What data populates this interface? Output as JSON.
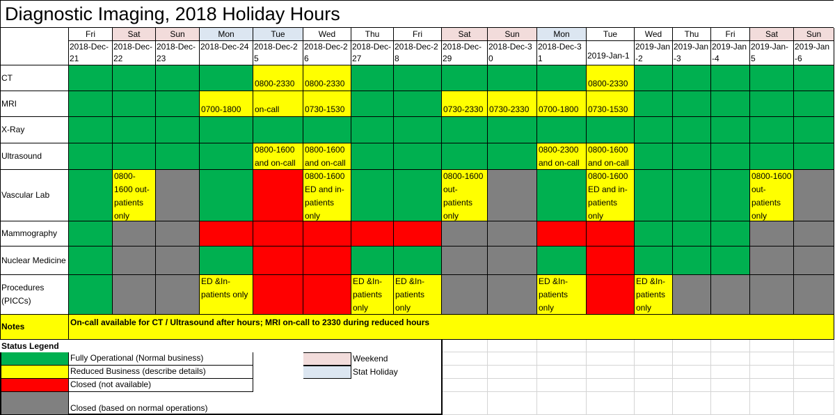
{
  "title": "Diagnostic Imaging, 2018 Holiday Hours",
  "columns": [
    {
      "day": "Fri",
      "date": "2018-Dec-21",
      "bg": "W"
    },
    {
      "day": "Sat",
      "date": "2018-Dec-22",
      "bg": "P"
    },
    {
      "day": "Sun",
      "date": "2018-Dec-23",
      "bg": "P"
    },
    {
      "day": "Mon",
      "date": "2018-Dec-24",
      "bg": "B"
    },
    {
      "day": "Tue",
      "date": "2018-Dec-25",
      "bg": "B"
    },
    {
      "day": "Wed",
      "date": "2018-Dec-26",
      "bg": "W"
    },
    {
      "day": "Thu",
      "date": "2018-Dec-27",
      "bg": "W"
    },
    {
      "day": "Fri",
      "date": "2018-Dec-28",
      "bg": "W"
    },
    {
      "day": "Sat",
      "date": "2018-Dec-29",
      "bg": "P"
    },
    {
      "day": "Sun",
      "date": "2018-Dec-30",
      "bg": "P"
    },
    {
      "day": "Mon",
      "date": "2018-Dec-31",
      "bg": "B"
    },
    {
      "day": "Tue",
      "date": "2019-Jan-1",
      "bg": "W"
    },
    {
      "day": "Wed",
      "date": "2019-Jan-2",
      "bg": "W"
    },
    {
      "day": "Thu",
      "date": "2019-Jan-3",
      "bg": "W"
    },
    {
      "day": "Fri",
      "date": "2019-Jan-4",
      "bg": "W"
    },
    {
      "day": "Sat",
      "date": "2019-Jan-5",
      "bg": "P"
    },
    {
      "day": "Sun",
      "date": "2019-Jan-6",
      "bg": "P"
    }
  ],
  "rows": [
    {
      "label": "CT",
      "cells": [
        {
          "s": "G",
          "t": ""
        },
        {
          "s": "G",
          "t": ""
        },
        {
          "s": "G",
          "t": ""
        },
        {
          "s": "G",
          "t": ""
        },
        {
          "s": "Y",
          "t": "0800-2330"
        },
        {
          "s": "Y",
          "t": "0800-2330"
        },
        {
          "s": "G",
          "t": ""
        },
        {
          "s": "G",
          "t": ""
        },
        {
          "s": "G",
          "t": ""
        },
        {
          "s": "G",
          "t": ""
        },
        {
          "s": "G",
          "t": ""
        },
        {
          "s": "Y",
          "t": "0800-2330"
        },
        {
          "s": "G",
          "t": ""
        },
        {
          "s": "G",
          "t": ""
        },
        {
          "s": "G",
          "t": ""
        },
        {
          "s": "G",
          "t": ""
        },
        {
          "s": "G",
          "t": ""
        }
      ]
    },
    {
      "label": "MRI",
      "cells": [
        {
          "s": "G",
          "t": ""
        },
        {
          "s": "G",
          "t": ""
        },
        {
          "s": "G",
          "t": ""
        },
        {
          "s": "Y",
          "t": "0700-1800"
        },
        {
          "s": "Y",
          "t": "on-call"
        },
        {
          "s": "Y",
          "t": "0730-1530"
        },
        {
          "s": "G",
          "t": ""
        },
        {
          "s": "G",
          "t": ""
        },
        {
          "s": "Y",
          "t": "0730-2330"
        },
        {
          "s": "Y",
          "t": "0730-2330"
        },
        {
          "s": "Y",
          "t": "0700-1800"
        },
        {
          "s": "Y",
          "t": "0730-1530"
        },
        {
          "s": "G",
          "t": ""
        },
        {
          "s": "G",
          "t": ""
        },
        {
          "s": "G",
          "t": ""
        },
        {
          "s": "G",
          "t": ""
        },
        {
          "s": "G",
          "t": ""
        }
      ]
    },
    {
      "label": "X-Ray",
      "cells": [
        {
          "s": "G",
          "t": ""
        },
        {
          "s": "G",
          "t": ""
        },
        {
          "s": "G",
          "t": ""
        },
        {
          "s": "G",
          "t": ""
        },
        {
          "s": "G",
          "t": ""
        },
        {
          "s": "G",
          "t": ""
        },
        {
          "s": "G",
          "t": ""
        },
        {
          "s": "G",
          "t": ""
        },
        {
          "s": "G",
          "t": ""
        },
        {
          "s": "G",
          "t": ""
        },
        {
          "s": "G",
          "t": ""
        },
        {
          "s": "G",
          "t": ""
        },
        {
          "s": "G",
          "t": ""
        },
        {
          "s": "G",
          "t": ""
        },
        {
          "s": "G",
          "t": ""
        },
        {
          "s": "G",
          "t": ""
        },
        {
          "s": "G",
          "t": ""
        }
      ]
    },
    {
      "label": "Ultrasound",
      "cells": [
        {
          "s": "G",
          "t": ""
        },
        {
          "s": "G",
          "t": ""
        },
        {
          "s": "G",
          "t": ""
        },
        {
          "s": "G",
          "t": ""
        },
        {
          "s": "Y",
          "t": "0800-1600 and on-call"
        },
        {
          "s": "Y",
          "t": "0800-1600 and on-call"
        },
        {
          "s": "G",
          "t": ""
        },
        {
          "s": "G",
          "t": ""
        },
        {
          "s": "G",
          "t": ""
        },
        {
          "s": "G",
          "t": ""
        },
        {
          "s": "Y",
          "t": "0800-2300 and on-call"
        },
        {
          "s": "Y",
          "t": "0800-1600 and on-call"
        },
        {
          "s": "G",
          "t": ""
        },
        {
          "s": "G",
          "t": ""
        },
        {
          "s": "G",
          "t": ""
        },
        {
          "s": "G",
          "t": ""
        },
        {
          "s": "G",
          "t": ""
        }
      ]
    },
    {
      "label": "Vascular Lab",
      "cells": [
        {
          "s": "G",
          "t": ""
        },
        {
          "s": "Y",
          "t": "0800-1600 out-patients only"
        },
        {
          "s": "X",
          "t": ""
        },
        {
          "s": "G",
          "t": ""
        },
        {
          "s": "R",
          "t": ""
        },
        {
          "s": "Y",
          "t": "0800-1600 ED and in-patients only"
        },
        {
          "s": "G",
          "t": ""
        },
        {
          "s": "G",
          "t": ""
        },
        {
          "s": "Y",
          "t": "0800-1600 out-patients only"
        },
        {
          "s": "X",
          "t": ""
        },
        {
          "s": "G",
          "t": ""
        },
        {
          "s": "Y",
          "t": "0800-1600 ED and in-patients only"
        },
        {
          "s": "G",
          "t": ""
        },
        {
          "s": "G",
          "t": ""
        },
        {
          "s": "G",
          "t": ""
        },
        {
          "s": "Y",
          "t": "0800-1600 out-patients only"
        },
        {
          "s": "X",
          "t": ""
        }
      ]
    },
    {
      "label": "Mammography",
      "cells": [
        {
          "s": "G",
          "t": ""
        },
        {
          "s": "X",
          "t": ""
        },
        {
          "s": "X",
          "t": ""
        },
        {
          "s": "R",
          "t": ""
        },
        {
          "s": "R",
          "t": ""
        },
        {
          "s": "R",
          "t": ""
        },
        {
          "s": "R",
          "t": ""
        },
        {
          "s": "R",
          "t": ""
        },
        {
          "s": "X",
          "t": ""
        },
        {
          "s": "X",
          "t": ""
        },
        {
          "s": "R",
          "t": ""
        },
        {
          "s": "R",
          "t": ""
        },
        {
          "s": "G",
          "t": ""
        },
        {
          "s": "G",
          "t": ""
        },
        {
          "s": "G",
          "t": ""
        },
        {
          "s": "X",
          "t": ""
        },
        {
          "s": "X",
          "t": ""
        }
      ]
    },
    {
      "label": "Nuclear Medicine",
      "cells": [
        {
          "s": "G",
          "t": ""
        },
        {
          "s": "X",
          "t": ""
        },
        {
          "s": "X",
          "t": ""
        },
        {
          "s": "G",
          "t": ""
        },
        {
          "s": "R",
          "t": ""
        },
        {
          "s": "R",
          "t": ""
        },
        {
          "s": "G",
          "t": ""
        },
        {
          "s": "G",
          "t": ""
        },
        {
          "s": "X",
          "t": ""
        },
        {
          "s": "X",
          "t": ""
        },
        {
          "s": "G",
          "t": ""
        },
        {
          "s": "R",
          "t": ""
        },
        {
          "s": "G",
          "t": ""
        },
        {
          "s": "G",
          "t": ""
        },
        {
          "s": "G",
          "t": ""
        },
        {
          "s": "X",
          "t": ""
        },
        {
          "s": "X",
          "t": ""
        }
      ]
    },
    {
      "label": "Procedures (PICCs)",
      "cells": [
        {
          "s": "G",
          "t": ""
        },
        {
          "s": "X",
          "t": ""
        },
        {
          "s": "X",
          "t": ""
        },
        {
          "s": "Y",
          "t": "ED &In-patients only"
        },
        {
          "s": "R",
          "t": ""
        },
        {
          "s": "R",
          "t": ""
        },
        {
          "s": "Y",
          "t": "ED &In-patients only"
        },
        {
          "s": "Y",
          "t": "ED &In-patients only"
        },
        {
          "s": "X",
          "t": ""
        },
        {
          "s": "X",
          "t": ""
        },
        {
          "s": "Y",
          "t": "ED &In-patients only"
        },
        {
          "s": "R",
          "t": ""
        },
        {
          "s": "Y",
          "t": "ED &In-patients only"
        },
        {
          "s": "X",
          "t": ""
        },
        {
          "s": "X",
          "t": ""
        },
        {
          "s": "X",
          "t": ""
        },
        {
          "s": "X",
          "t": ""
        }
      ]
    }
  ],
  "notes": {
    "label": "Notes",
    "text": "On-call available for CT / Ultrasound after hours; MRI on-call to 2330 during reduced hours"
  },
  "legend": {
    "title": "Status Legend",
    "items": [
      {
        "s": "G",
        "label": "Fully Operational (Normal business)"
      },
      {
        "s": "Y",
        "label": "Reduced Business (describe details)"
      },
      {
        "s": "R",
        "label": "Closed (not available)"
      },
      {
        "s": "X",
        "label": "Closed (based on normal operations)"
      }
    ],
    "day_items": [
      {
        "s": "P",
        "label": "Weekend"
      },
      {
        "s": "B",
        "label": "Stat Holiday"
      }
    ]
  },
  "colors": {
    "G": "#00b050",
    "Y": "#ffff00",
    "R": "#ff0000",
    "X": "#808080",
    "P": "#f2dcdb",
    "B": "#dce6f1"
  }
}
